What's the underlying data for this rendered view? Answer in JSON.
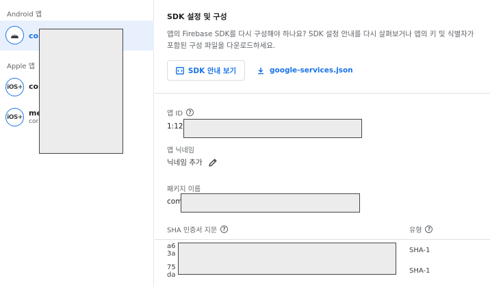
{
  "apps_panel": {
    "android_section": "Android 앱",
    "apple_section": "Apple 앱",
    "android_apps": [
      {
        "name": "cor",
        "icon": "android-icon"
      }
    ],
    "apple_apps": [
      {
        "name": "cor",
        "badge": "iOS+",
        "icon": "ios-icon"
      },
      {
        "name": "me",
        "subtitle": "cor",
        "badge": "iOS+",
        "icon": "ios-icon"
      }
    ]
  },
  "sdk": {
    "title": "SDK 설정 및 구성",
    "description": "앱의 Firebase SDK를 다시 구성해야 하나요? SDK 설정 안내를 다시 살펴보거나 앱의 키 및 식별자가 포함된 구성 파일을 다운로드하세요.",
    "guide_button": "SDK 안내 보기",
    "download_button": "google-services.json"
  },
  "details": {
    "app_id_label": "앱 ID",
    "app_id_value": "1:12",
    "nickname_label": "앱 닉네임",
    "nickname_value": "닉네임 추가",
    "package_label": "패키지 이름",
    "package_value": "com",
    "sha_label": "SHA 인증서 지문",
    "type_label": "유형",
    "sha_rows": [
      {
        "fingerprint_line1": "a6",
        "fingerprint_line2": "3a",
        "type": "SHA-1"
      },
      {
        "fingerprint_line1": "75",
        "fingerprint_line2": "da",
        "type": "SHA-1"
      }
    ]
  },
  "colors": {
    "accent": "#1a73e8",
    "selected_bg": "#e8f0fe",
    "muted_text": "#5f6368"
  }
}
